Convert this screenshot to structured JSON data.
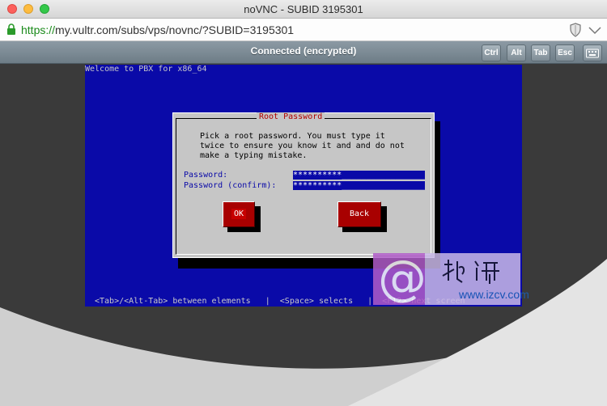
{
  "window": {
    "title": "noVNC - SUBID 3195301"
  },
  "urlbar": {
    "scheme": "https://",
    "rest": "my.vultr.com/subs/vps/novnc/?SUBID=3195301"
  },
  "novnc": {
    "status": "Connected (encrypted)",
    "keys": [
      "Ctrl",
      "Alt",
      "Tab",
      "Esc"
    ]
  },
  "console": {
    "welcome": "Welcome to PBX for x86_64",
    "dialog": {
      "title": "Root Password",
      "message": "Pick a root password. You must type it\ntwice to ensure you know it and and do not\nmake a typing mistake.",
      "password_label": "Password:",
      "password_value": "**********",
      "confirm_label": "Password (confirm):",
      "confirm_value": "**********",
      "ok_label": "OK",
      "back_label": "Back"
    },
    "help": "<Tab>/<Alt-Tab> between elements   |  <Space> selects   |  <F12> next screen"
  },
  "watermark": {
    "url": "www.izcv.com"
  },
  "colors": {
    "console_bg": "#0a0aa8",
    "dialog_bg": "#c6c6c6",
    "button_bg": "#a80000",
    "title_red": "#b00000",
    "url_green": "#1a8a1a"
  }
}
